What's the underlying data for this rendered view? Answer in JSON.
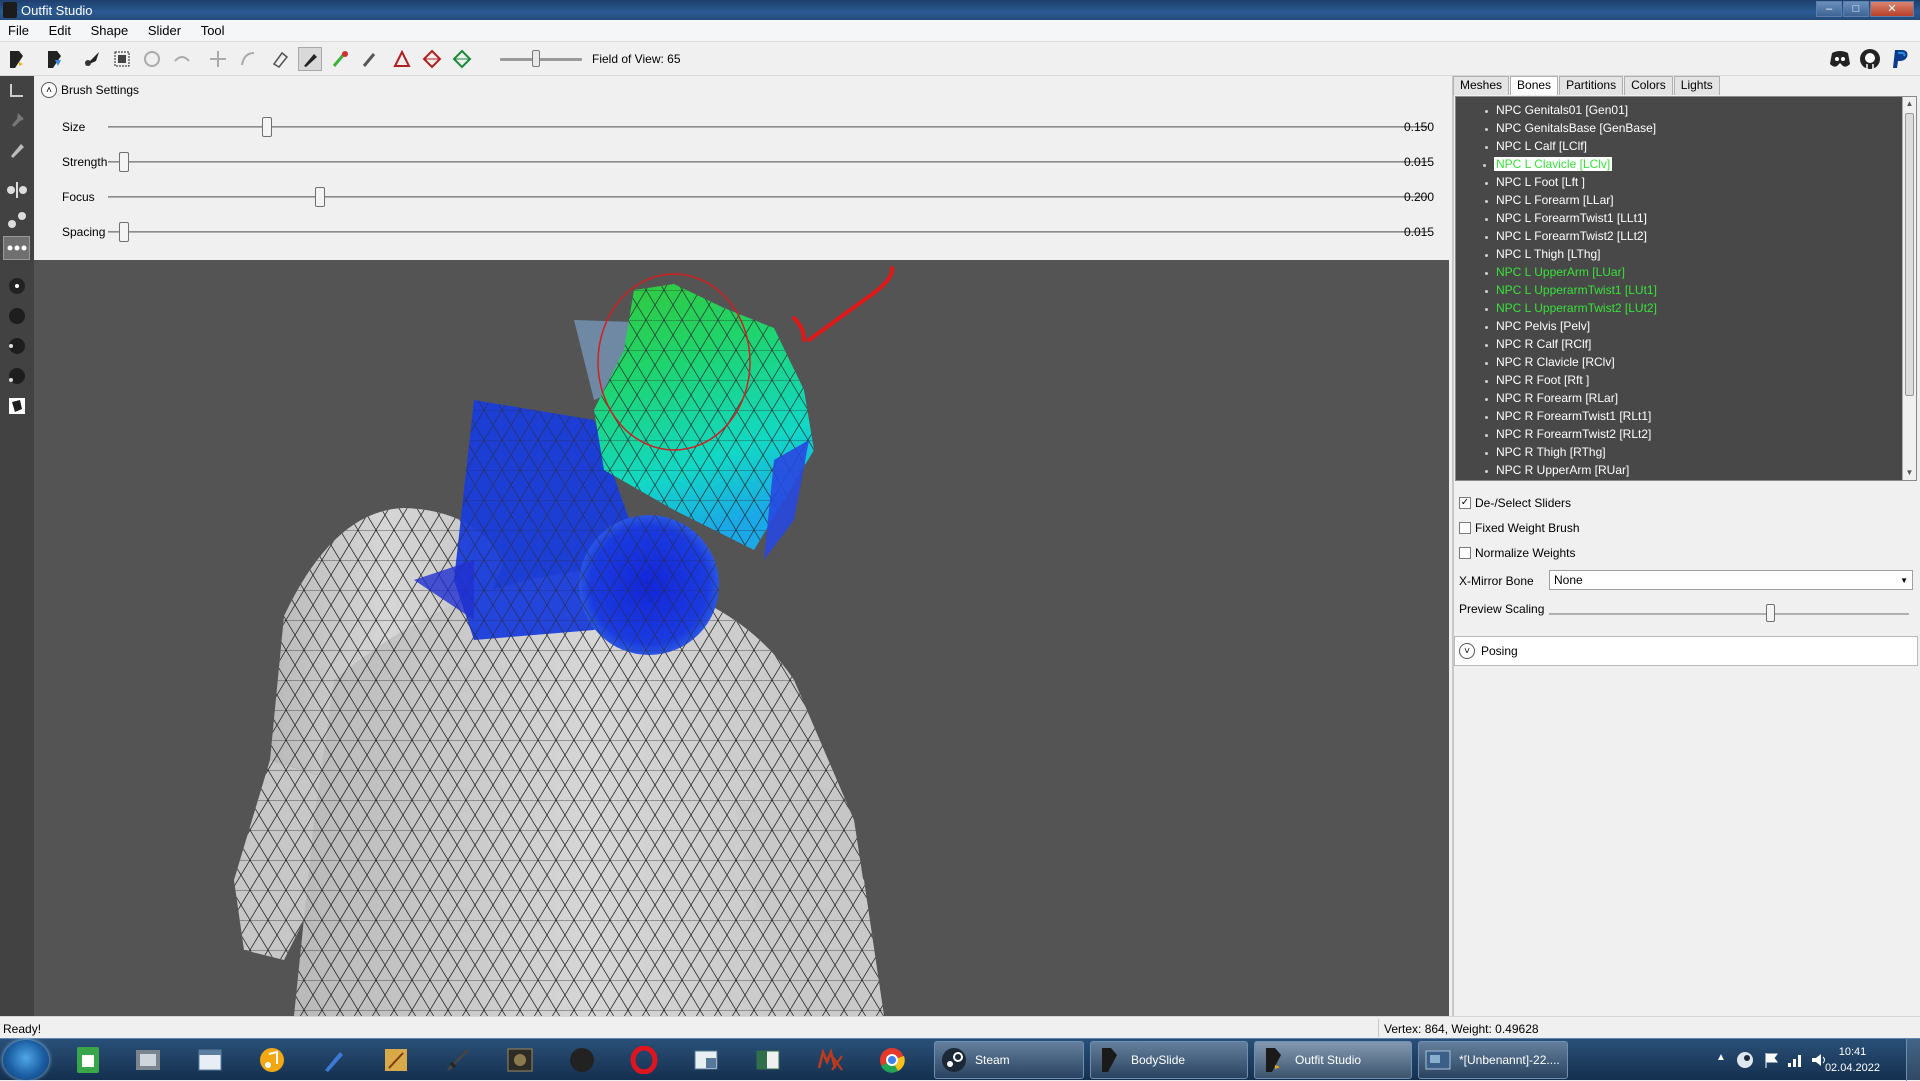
{
  "window": {
    "title": "Outfit Studio"
  },
  "menu": [
    "File",
    "Edit",
    "Shape",
    "Slider",
    "Tool"
  ],
  "toolbar": {
    "fov_label": "Field of View: 65",
    "fov_value": 65
  },
  "brush_settings": {
    "header": "Brush Settings",
    "sliders": [
      {
        "label": "Size",
        "value": "0.150",
        "level": 0.15
      },
      {
        "label": "Strength",
        "value": "0.015",
        "level": 0.015
      },
      {
        "label": "Focus",
        "value": "0.200",
        "level": 0.2
      },
      {
        "label": "Spacing",
        "value": "0.015",
        "level": 0.015
      }
    ]
  },
  "right_panel": {
    "tabs": [
      "Meshes",
      "Bones",
      "Partitions",
      "Colors",
      "Lights"
    ],
    "selected_tab": "Bones",
    "bones": [
      {
        "name": "NPC Genitals01 [Gen01]",
        "state": "normal"
      },
      {
        "name": "NPC GenitalsBase [GenBase]",
        "state": "normal"
      },
      {
        "name": "NPC L Calf [LClf]",
        "state": "normal"
      },
      {
        "name": "NPC L Clavicle [LClv]",
        "state": "selected"
      },
      {
        "name": "NPC L Foot [Lft ]",
        "state": "normal"
      },
      {
        "name": "NPC L Forearm [LLar]",
        "state": "normal"
      },
      {
        "name": "NPC L ForearmTwist1 [LLt1]",
        "state": "normal"
      },
      {
        "name": "NPC L ForearmTwist2 [LLt2]",
        "state": "normal"
      },
      {
        "name": "NPC L Thigh [LThg]",
        "state": "normal"
      },
      {
        "name": "NPC L UpperArm [LUar]",
        "state": "green"
      },
      {
        "name": "NPC L UpperarmTwist1 [LUt1]",
        "state": "green"
      },
      {
        "name": "NPC L UpperarmTwist2 [LUt2]",
        "state": "green"
      },
      {
        "name": "NPC Pelvis [Pelv]",
        "state": "normal"
      },
      {
        "name": "NPC R Calf [RClf]",
        "state": "normal"
      },
      {
        "name": "NPC R Clavicle [RClv]",
        "state": "normal"
      },
      {
        "name": "NPC R Foot [Rft ]",
        "state": "normal"
      },
      {
        "name": "NPC R Forearm [RLar]",
        "state": "normal"
      },
      {
        "name": "NPC R ForearmTwist1 [RLt1]",
        "state": "normal"
      },
      {
        "name": "NPC R ForearmTwist2 [RLt2]",
        "state": "normal"
      },
      {
        "name": "NPC R Thigh [RThg]",
        "state": "normal"
      },
      {
        "name": "NPC R UpperArm [RUar]",
        "state": "normal"
      }
    ],
    "options": {
      "deselect_sliders": {
        "label": "De-/Select Sliders",
        "checked": true
      },
      "fixed_weight_brush": {
        "label": "Fixed Weight Brush",
        "checked": false
      },
      "normalize_weights": {
        "label": "Normalize Weights",
        "checked": false
      },
      "xmirror_label": "X-Mirror Bone",
      "xmirror_value": "None",
      "preview_scaling_label": "Preview Scaling",
      "preview_scaling_level": 0.79
    },
    "posing_label": "Posing"
  },
  "status": {
    "left": "Ready!",
    "right": "Vertex: 864, Weight: 0.49628"
  },
  "taskbar": {
    "tasks": [
      {
        "label": "Steam",
        "icon": "steam-icon"
      },
      {
        "label": "BodySlide",
        "icon": "bodyslide-icon"
      },
      {
        "label": "Outfit Studio",
        "icon": "outfit-studio-icon",
        "active": true
      },
      {
        "label": "*[Unbenannt]-22....",
        "icon": "image-editor-icon"
      }
    ],
    "time": "10:41",
    "date": "02.04.2022"
  },
  "colors": {
    "green_bone": "#37e23a",
    "viewport_bg": "#545454",
    "panel_dark": "#484848",
    "annotation_red": "#e01818"
  }
}
